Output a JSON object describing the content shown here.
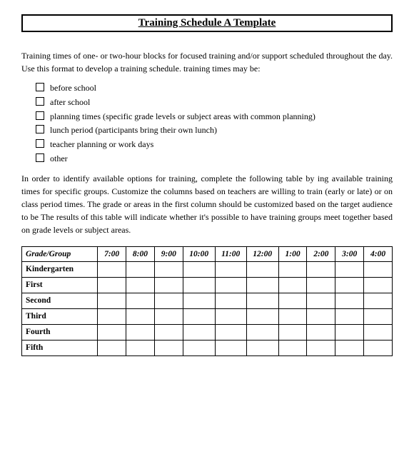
{
  "title": "Training Schedule A Template",
  "intro": "Training times of one- or two-hour blocks for focused training and/or support scheduled throughout the day. Use this format to develop a training schedule. training times may be:",
  "checkboxItems": [
    "before school",
    "after school",
    "planning times (specific grade levels or subject areas with common planning)",
    "lunch period (participants bring their own lunch)",
    "teacher planning or work days",
    "other"
  ],
  "bodyText": "In order to identify available options for training, complete the following table by ing available training times for specific groups. Customize the columns based on teachers are willing to train (early or late) or on class period times. The grade or areas in the first column should be customized based on the target audience to be The results of this table will indicate whether it's possible to have training groups meet together based on grade levels or subject areas.",
  "table": {
    "headers": [
      "Grade/Group",
      "7:00",
      "8:00",
      "9:00",
      "10:00",
      "11:00",
      "12:00",
      "1:00",
      "2:00",
      "3:00",
      "4:00"
    ],
    "rows": [
      [
        "Kindergarten",
        "",
        "",
        "",
        "",
        "",
        "",
        "",
        "",
        "",
        ""
      ],
      [
        "First",
        "",
        "",
        "",
        "",
        "",
        "",
        "",
        "",
        "",
        ""
      ],
      [
        "Second",
        "",
        "",
        "",
        "",
        "",
        "",
        "",
        "",
        "",
        ""
      ],
      [
        "Third",
        "",
        "",
        "",
        "",
        "",
        "",
        "",
        "",
        "",
        ""
      ],
      [
        "Fourth",
        "",
        "",
        "",
        "",
        "",
        "",
        "",
        "",
        "",
        ""
      ],
      [
        "Fifth",
        "",
        "",
        "",
        "",
        "",
        "",
        "",
        "",
        "",
        ""
      ]
    ]
  }
}
